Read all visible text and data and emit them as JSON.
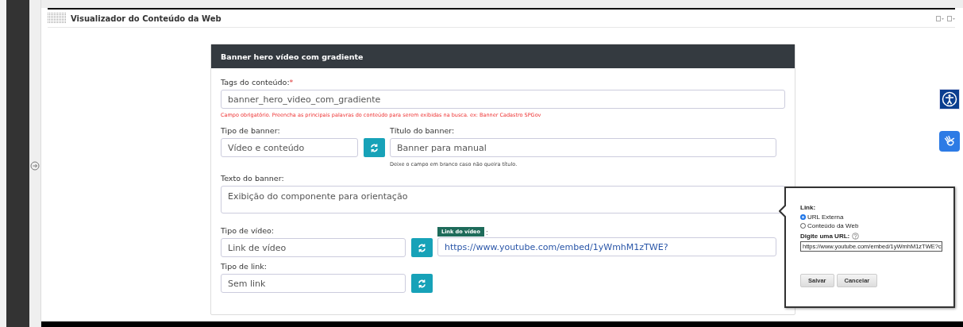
{
  "window": {
    "title": "Visualizador do Conteúdo da Web"
  },
  "card": {
    "title": "Banner hero vídeo com gradiente",
    "tags": {
      "label": "Tags do conteúdo:",
      "required_mark": "*",
      "value": "banner_hero_video_com_gradiente",
      "error": "Campo obrigatório. Preencha as principais palavras do conteúdo para serem exibidas na busca. ex: Banner Cadastro SPGov"
    },
    "banner_type": {
      "label": "Tipo de banner:",
      "value": "Vídeo e conteúdo"
    },
    "banner_title": {
      "label": "Título do banner:",
      "value": "Banner para manual",
      "hint": "Deixe o campo em branco caso não queira título."
    },
    "banner_text": {
      "label": "Texto do banner:",
      "value": "Exibição do componente para orientação"
    },
    "video_type": {
      "label": "Tipo de vídeo:",
      "value": "Link de vídeo"
    },
    "video_link": {
      "tag": "Link do vídeo",
      "suffix": ":",
      "value": "https://www.youtube.com/embed/1yWmhM1zTWE?"
    },
    "link_type": {
      "label": "Tipo de link:",
      "value": "Sem link"
    }
  },
  "popover": {
    "label": "Link:",
    "options": [
      {
        "label": "URL Externa",
        "selected": true
      },
      {
        "label": "Conteúdo da Web",
        "selected": false
      }
    ],
    "url_label": "Digite uma URL:",
    "url_value": "https://www.youtube.com/embed/1yWmhM1zTWE?c",
    "buttons": [
      "Salvar",
      "Cancelar"
    ]
  }
}
